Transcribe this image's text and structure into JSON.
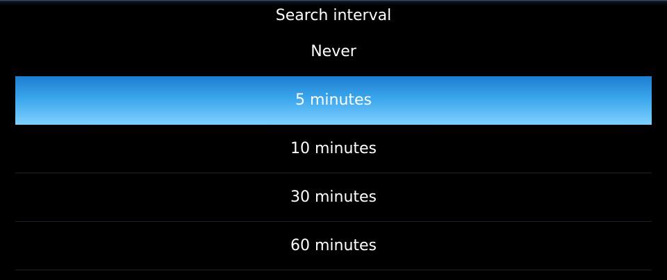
{
  "dialog": {
    "title": "Search interval"
  },
  "options": [
    {
      "label": "Never",
      "selected": false
    },
    {
      "label": "5 minutes",
      "selected": true
    },
    {
      "label": "10 minutes",
      "selected": false
    },
    {
      "label": "30 minutes",
      "selected": false
    },
    {
      "label": "60 minutes",
      "selected": false
    }
  ],
  "colors": {
    "background": "#000000",
    "selected_top": "#1e7ed0",
    "selected_bottom": "#7fd0ff",
    "text": "#ffffff",
    "divider": "#1a2230"
  }
}
